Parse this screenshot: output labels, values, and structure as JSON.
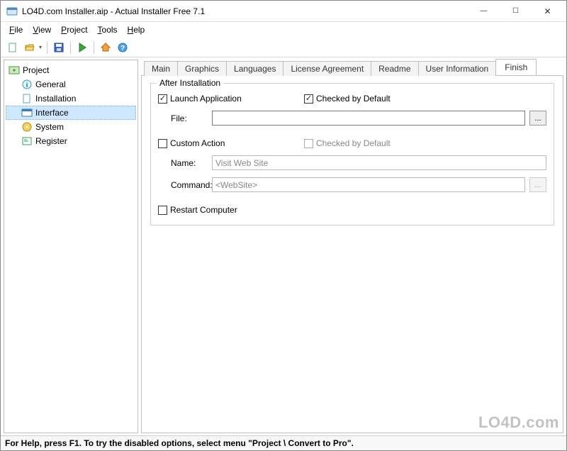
{
  "window": {
    "title": "LO4D.com Installer.aip - Actual Installer Free 7.1"
  },
  "menu": {
    "file": "File",
    "view": "View",
    "project": "Project",
    "tools": "Tools",
    "help": "Help"
  },
  "sidebar": {
    "root": "Project",
    "items": [
      {
        "label": "General"
      },
      {
        "label": "Installation"
      },
      {
        "label": "Interface"
      },
      {
        "label": "System"
      },
      {
        "label": "Register"
      }
    ]
  },
  "tabs": [
    {
      "label": "Main"
    },
    {
      "label": "Graphics"
    },
    {
      "label": "Languages"
    },
    {
      "label": "License Agreement"
    },
    {
      "label": "Readme"
    },
    {
      "label": "User Information"
    },
    {
      "label": "Finish"
    }
  ],
  "group": {
    "title": "After Installation",
    "launch": {
      "label": "Launch Application",
      "checked": true,
      "defaultLabel": "Checked by Default",
      "defaultChecked": true,
      "fileLabel": "File:",
      "fileValue": ""
    },
    "custom": {
      "label": "Custom Action",
      "checked": false,
      "defaultLabel": "Checked by Default",
      "defaultChecked": false,
      "nameLabel": "Name:",
      "nameValue": "Visit Web Site",
      "commandLabel": "Command:",
      "commandValue": "<WebSite>"
    },
    "restart": {
      "label": "Restart Computer",
      "checked": false
    }
  },
  "status": {
    "text": "For Help, press F1.  To try the disabled options, select menu \"Project \\ Convert to Pro\"."
  },
  "watermark": "LO4D.com",
  "browse": "..."
}
